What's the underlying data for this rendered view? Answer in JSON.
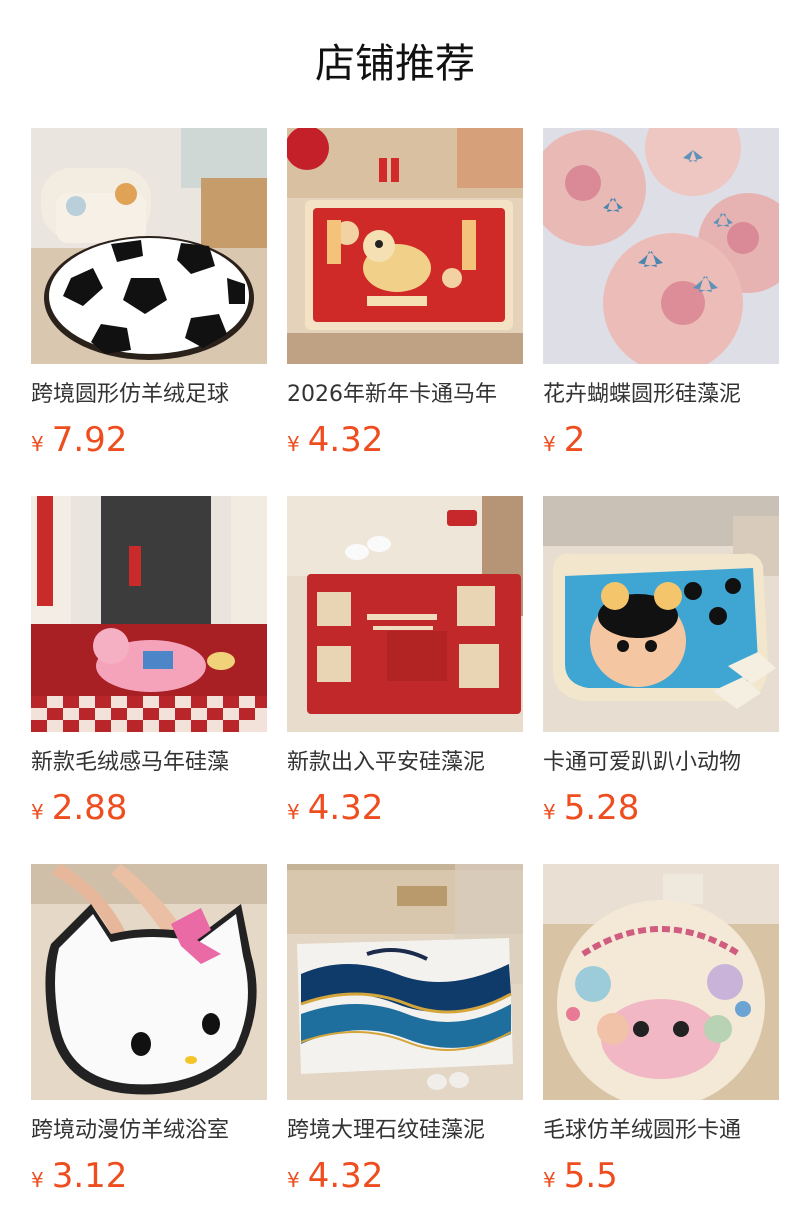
{
  "header": {
    "title": "店铺推荐"
  },
  "colors": {
    "price": "#ee4d1f"
  },
  "products": [
    {
      "title": "跨境圆形仿羊绒足球",
      "currency": "¥",
      "price": "7.92",
      "image": "soccer-ball-round-rug"
    },
    {
      "title": "2026年新年卡通马年",
      "currency": "¥",
      "price": "4.32",
      "image": "new-year-horse-door-mat"
    },
    {
      "title": "花卉蝴蝶圆形硅藻泥",
      "currency": "¥",
      "price": "2",
      "image": "flower-butterfly-round-mats"
    },
    {
      "title": "新款毛绒感马年硅藻",
      "currency": "¥",
      "price": "2.88",
      "image": "plush-horse-checker-mat"
    },
    {
      "title": "新款出入平安硅藻泥",
      "currency": "¥",
      "price": "4.32",
      "image": "red-calligraphy-door-mat"
    },
    {
      "title": "卡通可爱趴趴小动物",
      "currency": "¥",
      "price": "5.28",
      "image": "cartoon-animal-bath-mat"
    },
    {
      "title": "跨境动漫仿羊绒浴室",
      "currency": "¥",
      "price": "3.12",
      "image": "hello-kitty-bath-mat"
    },
    {
      "title": "跨境大理石纹硅藻泥",
      "currency": "¥",
      "price": "4.32",
      "image": "marble-pattern-bath-mat"
    },
    {
      "title": "毛球仿羊绒圆形卡通",
      "currency": "¥",
      "price": "5.5",
      "image": "happy-day-round-rug"
    }
  ]
}
